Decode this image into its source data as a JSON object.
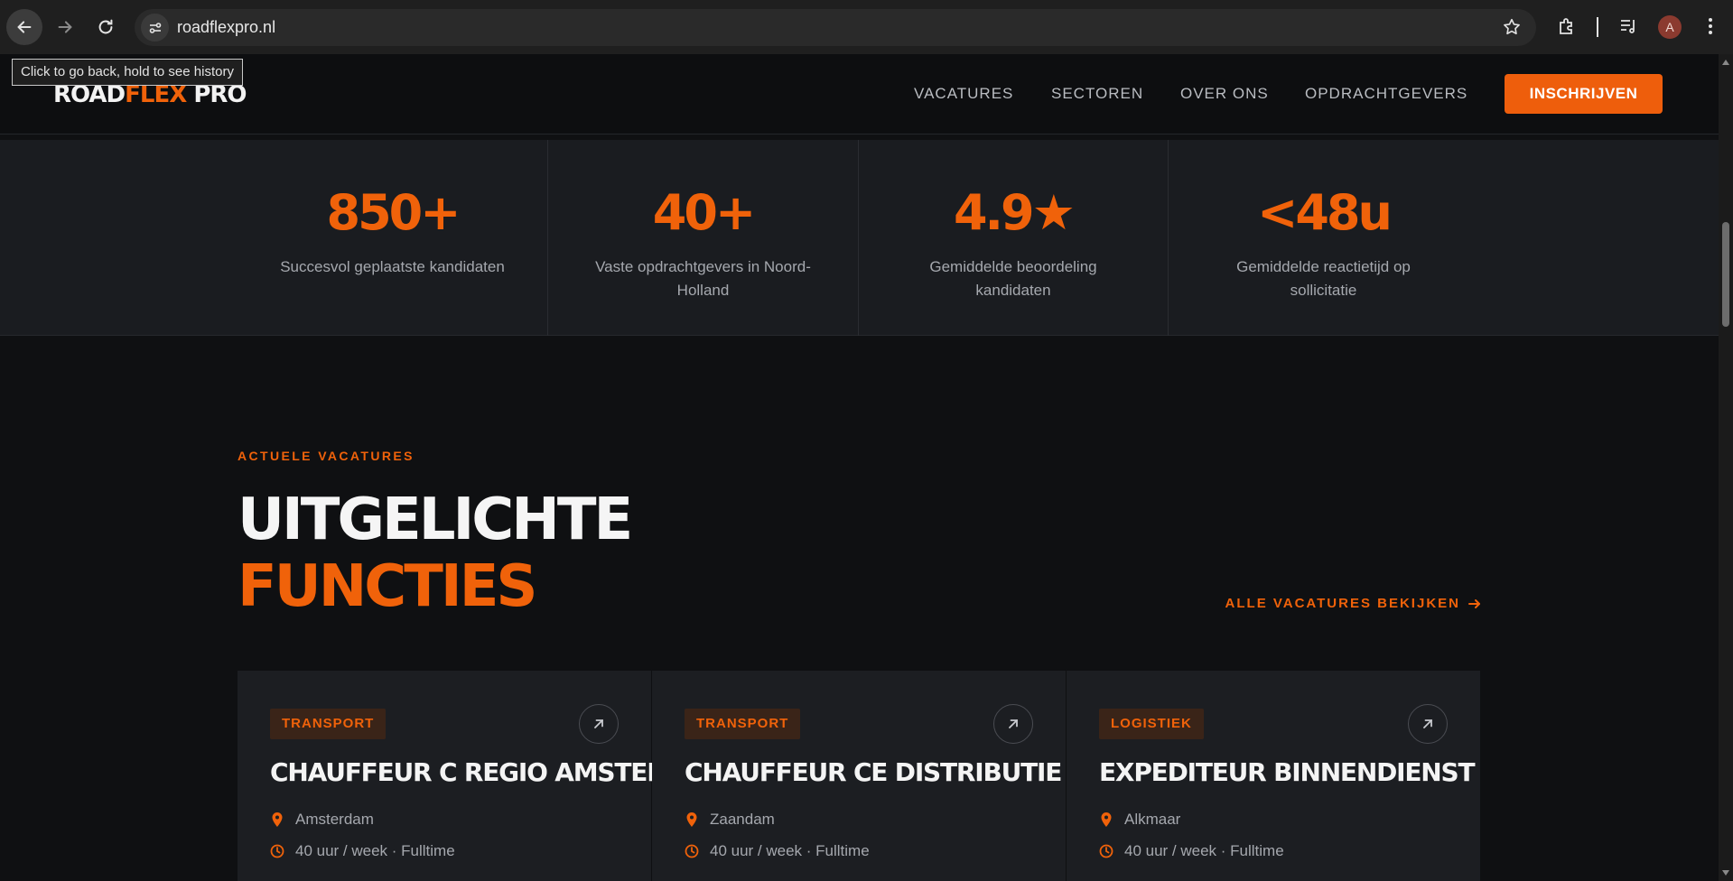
{
  "browser": {
    "url": "roadflexpro.nl",
    "tooltip": "Click to go back, hold to see history",
    "avatar_letter": "A"
  },
  "header": {
    "logo_part1": "ROAD",
    "logo_part2": "FLEX",
    "logo_part3": " PRO",
    "nav": [
      "VACATURES",
      "SECTOREN",
      "OVER ONS",
      "OPDRACHTGEVERS"
    ],
    "cta": "INSCHRIJVEN"
  },
  "stats": [
    {
      "value": "850+",
      "label": "Succesvol geplaatste kandidaten"
    },
    {
      "value": "40+",
      "label": "Vaste opdrachtgevers in Noord-Holland"
    },
    {
      "value": "4.9★",
      "label": "Gemiddelde beoordeling kandidaten"
    },
    {
      "value": "<48u",
      "label": "Gemiddelde reactietijd op sollicitatie"
    }
  ],
  "featured": {
    "eyebrow": "ACTUELE VACATURES",
    "title_line1": "UITGELICHTE",
    "title_line2": "FUNCTIES",
    "all_link": "ALLE VACATURES BEKIJKEN"
  },
  "jobs": [
    {
      "tag": "TRANSPORT",
      "title": "CHAUFFEUR C REGIO AMSTERDAM",
      "location": "Amsterdam",
      "hours": "40 uur / week · Fulltime"
    },
    {
      "tag": "TRANSPORT",
      "title": "CHAUFFEUR CE DISTRIBUTIE",
      "location": "Zaandam",
      "hours": "40 uur / week · Fulltime"
    },
    {
      "tag": "LOGISTIEK",
      "title": "EXPEDITEUR BINNENDIENST",
      "location": "Alkmaar",
      "hours": "40 uur / week · Fulltime"
    }
  ],
  "colors": {
    "accent": "#f0620a",
    "background": "#0f1012",
    "panel": "#1a1c20"
  }
}
